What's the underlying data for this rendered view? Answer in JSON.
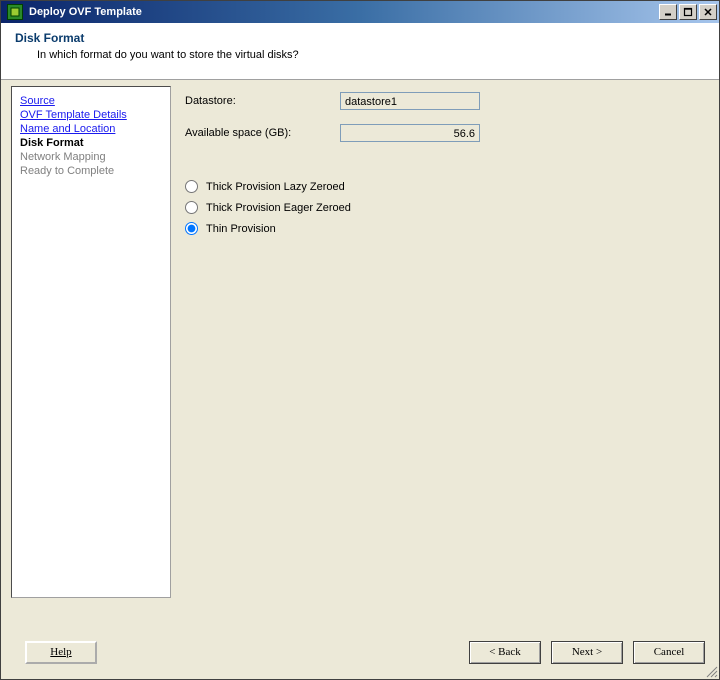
{
  "titlebar": {
    "title": "Deploy OVF Template"
  },
  "header": {
    "title": "Disk Format",
    "subtitle": "In which format do you want to store the virtual disks?"
  },
  "nav": {
    "items": [
      {
        "label": "Source",
        "state": "link"
      },
      {
        "label": "OVF Template Details",
        "state": "link"
      },
      {
        "label": "Name and Location",
        "state": "link"
      },
      {
        "label": "Disk Format",
        "state": "current"
      },
      {
        "label": "Network Mapping",
        "state": "disabled"
      },
      {
        "label": "Ready to Complete",
        "state": "disabled"
      }
    ]
  },
  "form": {
    "datastore_label": "Datastore:",
    "datastore_value": "datastore1",
    "avail_label": "Available space (GB):",
    "avail_value": "56.6",
    "options": [
      {
        "label": "Thick Provision Lazy Zeroed",
        "selected": false
      },
      {
        "label": "Thick Provision Eager Zeroed",
        "selected": false
      },
      {
        "label": "Thin Provision",
        "selected": true
      }
    ]
  },
  "footer": {
    "help": "Help",
    "back": "< Back",
    "next": "Next >",
    "cancel": "Cancel"
  }
}
